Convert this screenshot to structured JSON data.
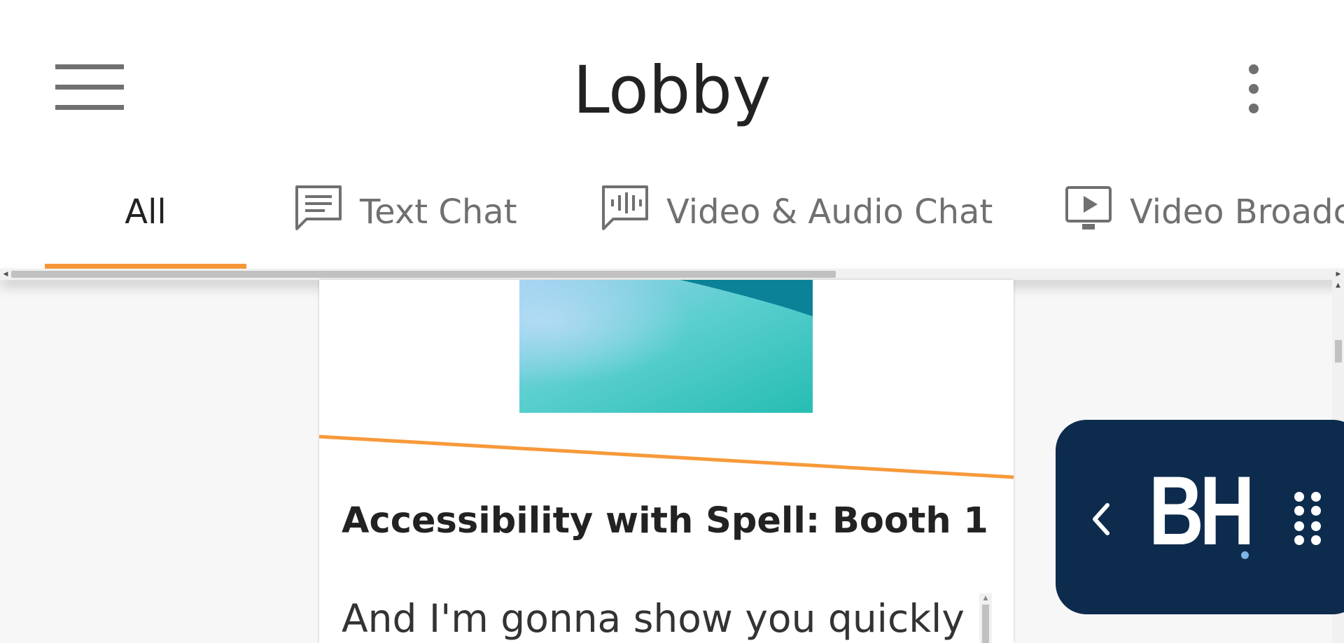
{
  "header": {
    "title": "Lobby",
    "menu_icon": "hamburger-menu-icon",
    "more_icon": "more-vertical-icon"
  },
  "tabs": [
    {
      "label": "All",
      "icon": "",
      "active": true
    },
    {
      "label": "Text Chat",
      "icon": "chat-message-icon",
      "active": false
    },
    {
      "label": "Video & Audio Chat",
      "icon": "audio-wave-chat-icon",
      "active": false
    },
    {
      "label": "Video Broadcast",
      "icon": "video-play-icon",
      "active": false
    }
  ],
  "card": {
    "title": "Accessibility with Spell: Booth 1",
    "caption": "And I'm gonna show you quickly"
  },
  "widget": {
    "logo_text": "BH",
    "collapse_icon": "chevron-left-icon",
    "grip_icon": "drag-handle-icon"
  },
  "colors": {
    "accent": "#f7993a",
    "widget_bg": "#0d2b4d",
    "icon_gray": "#707070",
    "text_dark": "#222222"
  }
}
